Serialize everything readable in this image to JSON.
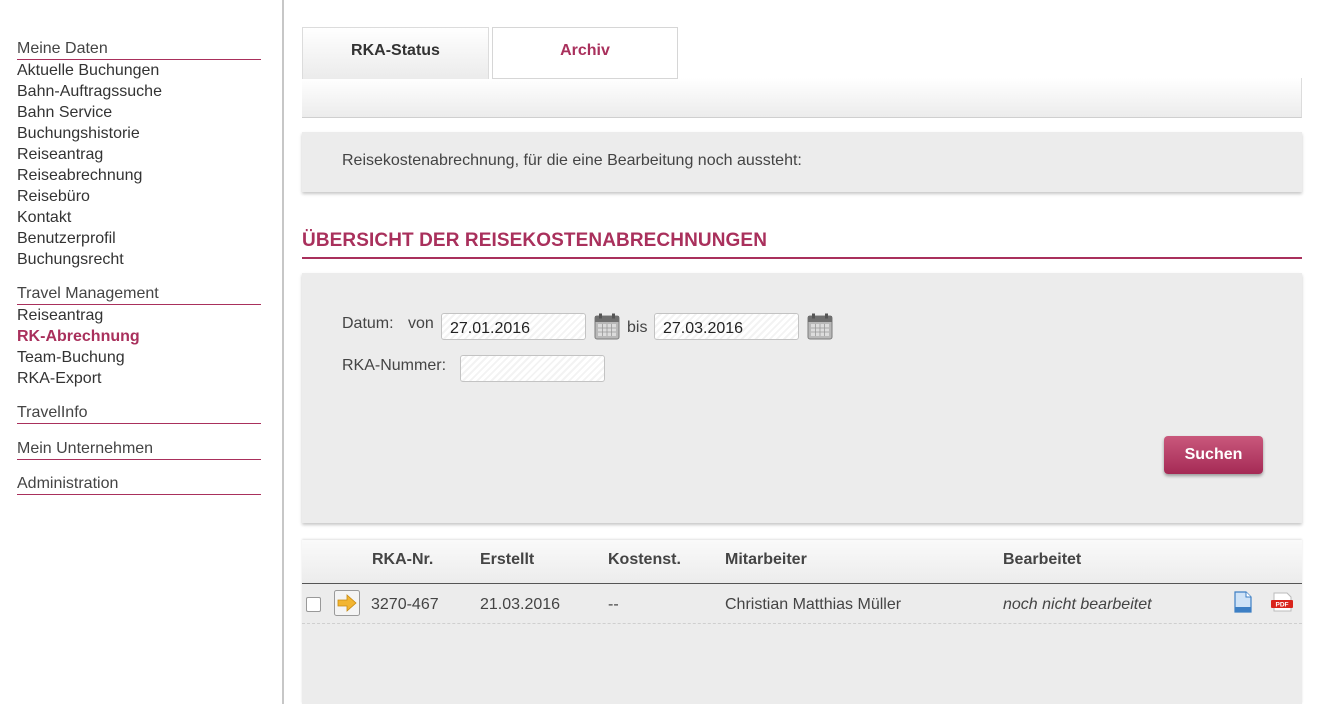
{
  "sidebar": {
    "groups": [
      {
        "title": "Meine Daten",
        "items": [
          "Aktuelle Buchungen",
          "Bahn-Auftragssuche",
          "Bahn Service",
          "Buchungshistorie",
          "Reiseantrag",
          "Reiseabrechnung",
          "Reisebüro",
          "Kontakt",
          "Benutzerprofil",
          "Buchungsrecht"
        ]
      },
      {
        "title": "Travel Management",
        "items": [
          "Reiseantrag",
          "RK-Abrechnung",
          "Team-Buchung",
          "RKA-Export"
        ]
      },
      {
        "title": "TravelInfo",
        "items": []
      },
      {
        "title": "Mein Unternehmen",
        "items": []
      },
      {
        "title": "Administration",
        "items": []
      }
    ],
    "active_item": "RK-Abrechnung"
  },
  "tabs": {
    "status": "RKA-Status",
    "archive": "Archiv"
  },
  "info": {
    "text": "Reisekostenabrechnung, für die eine Bearbeitung noch aussteht:"
  },
  "section_title": "ÜBERSICHT DER REISEKOSTENABRECHNUNGEN",
  "filter": {
    "date_label": "Datum:",
    "from_label": "von",
    "from_value": "27.01.2016",
    "to_label": "bis",
    "to_value": "27.03.2016",
    "number_label": "RKA-Nummer:",
    "number_value": "",
    "search_label": "Suchen"
  },
  "table": {
    "headers": {
      "nr": "RKA-Nr.",
      "created": "Erstellt",
      "cost": "Kostenst.",
      "employee": "Mitarbeiter",
      "status": "Bearbeitet"
    },
    "rows": [
      {
        "nr": "3270-467",
        "created": "21.03.2016",
        "cost": "--",
        "employee": "Christian Matthias  Müller",
        "status": "noch nicht bearbeitet"
      }
    ]
  },
  "colors": {
    "accent": "#a9305c",
    "panel": "#ececec"
  },
  "icons": {
    "calendar": "calendar-icon",
    "open": "arrow-right-icon",
    "document": "document-icon",
    "pdf": "pdf-icon"
  }
}
